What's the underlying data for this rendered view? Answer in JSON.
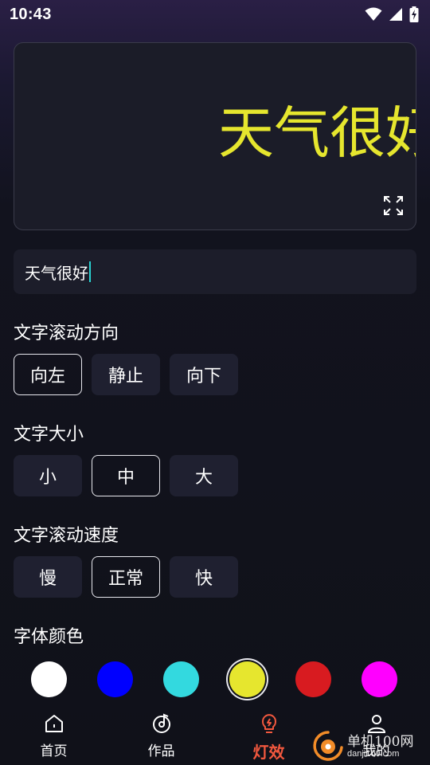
{
  "status_bar": {
    "time": "10:43",
    "icons": [
      "wifi-icon",
      "signal-icon",
      "battery-charging-icon"
    ]
  },
  "preview": {
    "text": "天气很好",
    "text_color": "#e6e62e",
    "icon": "fullscreen-icon"
  },
  "input": {
    "value": "天气很好",
    "caret_color": "#2ad1d1"
  },
  "direction": {
    "title": "文字滚动方向",
    "options": [
      {
        "label": "向左",
        "selected": true
      },
      {
        "label": "静止",
        "selected": false
      },
      {
        "label": "向下",
        "selected": false
      }
    ]
  },
  "size": {
    "title": "文字大小",
    "options": [
      {
        "label": "小",
        "selected": false
      },
      {
        "label": "中",
        "selected": true
      },
      {
        "label": "大",
        "selected": false
      }
    ]
  },
  "speed": {
    "title": "文字滚动速度",
    "options": [
      {
        "label": "慢",
        "selected": false
      },
      {
        "label": "正常",
        "selected": true
      },
      {
        "label": "快",
        "selected": false
      }
    ]
  },
  "font_color": {
    "title": "字体颜色",
    "swatches": [
      {
        "color": "#ffffff",
        "selected": false
      },
      {
        "color": "#0000ff",
        "selected": false
      },
      {
        "color": "#33d9df",
        "selected": false
      },
      {
        "color": "#e6e62e",
        "selected": true
      },
      {
        "color": "#d81b20",
        "selected": false
      },
      {
        "color": "#ff00ff",
        "selected": false
      }
    ]
  },
  "nav": {
    "items": [
      {
        "label": "首页",
        "icon": "home-icon",
        "active": false
      },
      {
        "label": "作品",
        "icon": "music-disc-icon",
        "active": false
      },
      {
        "label": "灯效",
        "icon": "lightbulb-icon",
        "active": true
      },
      {
        "label": "我的",
        "icon": "user-icon",
        "active": false
      }
    ],
    "active_color": "#f2583e"
  },
  "watermark": {
    "title": "单机100网",
    "url": "danji100.com"
  }
}
